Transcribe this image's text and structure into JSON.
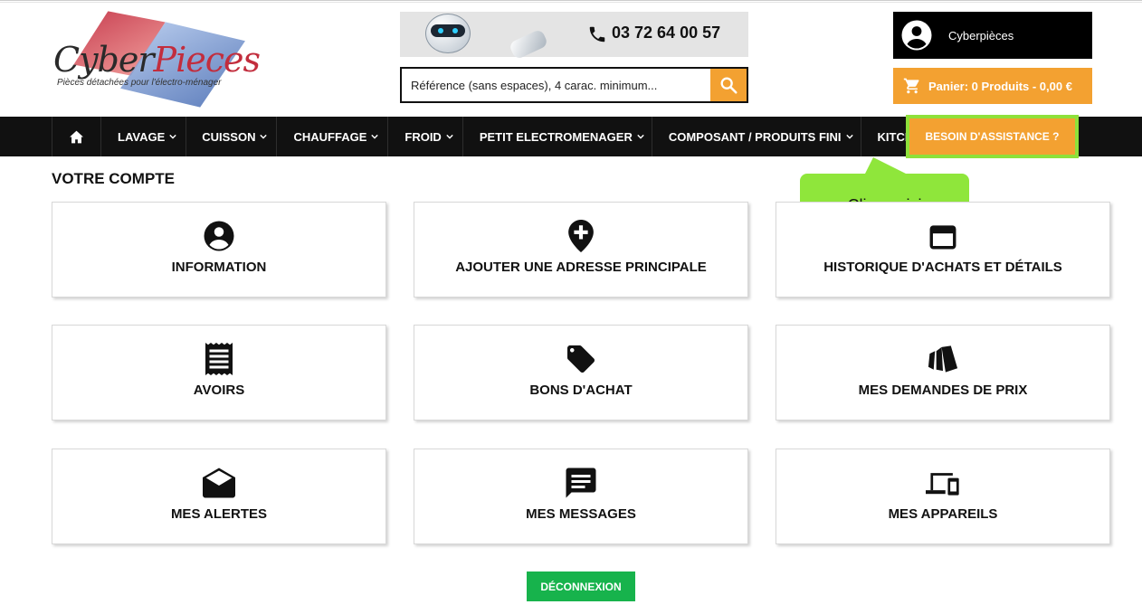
{
  "header": {
    "logo": {
      "brand_part1": "Cyber",
      "brand_part2": "Pieces",
      "tagline": "Pièces détachées pour l'électro-ménager"
    },
    "phone": "03 72 64 00 57",
    "search": {
      "placeholder": "Référence (sans espaces), 4 carac. minimum..."
    },
    "account_name": "Cyberpièces",
    "cart_label": "Panier: 0 Produits - 0,00 €"
  },
  "nav": {
    "items": [
      "LAVAGE",
      "CUISSON",
      "CHAUFFAGE",
      "FROID",
      "PETIT ELECTROMENAGER",
      "COMPOSANT / PRODUITS FINI",
      "KITCHENAID"
    ],
    "assist": "BESOIN D'ASSISTANCE ?"
  },
  "tooltip": "Cliquez ici",
  "page_title": "VOTRE COMPTE",
  "cards": [
    {
      "label": "INFORMATION",
      "icon": "account-circle-icon"
    },
    {
      "label": "AJOUTER UNE ADRESSE PRINCIPALE",
      "icon": "add-location-icon"
    },
    {
      "label": "HISTORIQUE D'ACHATS ET DÉTAILS",
      "icon": "calendar-icon"
    },
    {
      "label": "AVOIRS",
      "icon": "receipt-icon"
    },
    {
      "label": "BONS D'ACHAT",
      "icon": "tag-icon"
    },
    {
      "label": "MES DEMANDES DE PRIX",
      "icon": "price-cards-icon"
    },
    {
      "label": "MES ALERTES",
      "icon": "open-envelope-icon"
    },
    {
      "label": "MES MESSAGES",
      "icon": "message-icon"
    },
    {
      "label": "MES APPAREILS",
      "icon": "devices-icon"
    }
  ],
  "logout": "DÉCONNEXION",
  "colors": {
    "accent_orange": "#f3a131",
    "highlight_green": "#8ee03a",
    "logout_green": "#17b34c",
    "nav_bg": "#111111"
  }
}
